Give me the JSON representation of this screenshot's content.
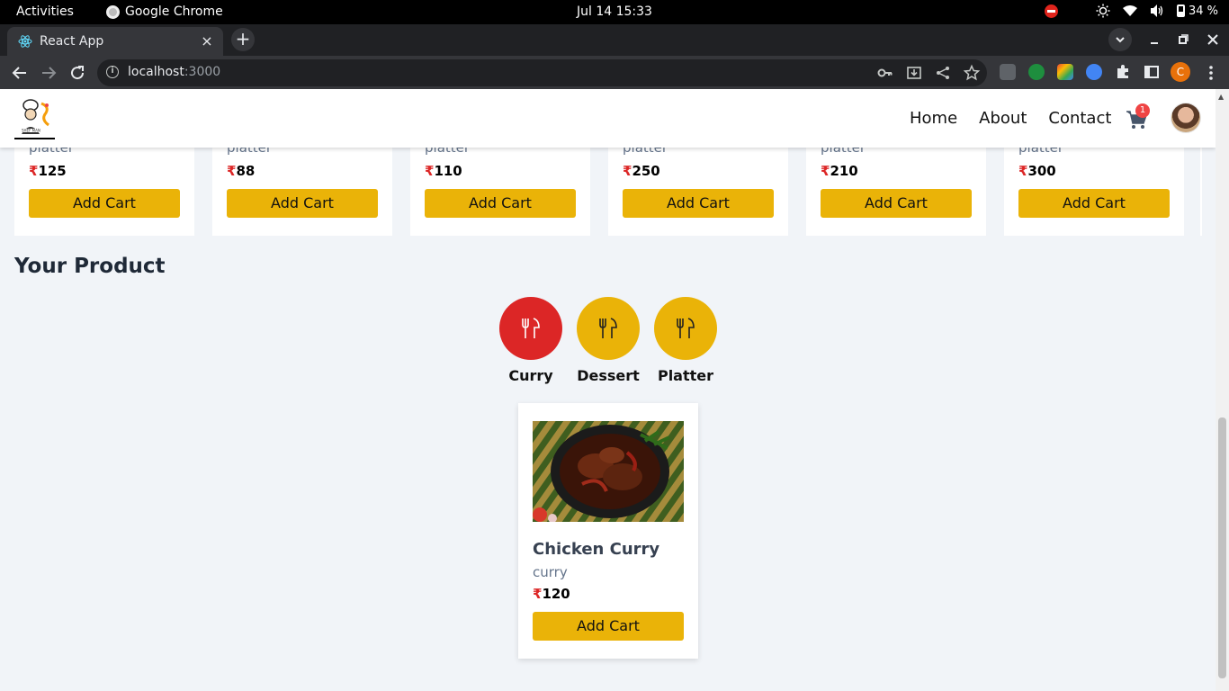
{
  "os": {
    "activities": "Activities",
    "app_name": "Google Chrome",
    "clock": "Jul 14  15:33",
    "battery": "34 %"
  },
  "browser": {
    "tab_title": "React App",
    "tab_close": "×",
    "new_tab": "+",
    "url_host": "localhost",
    "url_port": ":3000",
    "profile_initial": "C"
  },
  "header": {
    "nav": [
      "Home",
      "About",
      "Contact"
    ],
    "cart_count": "1"
  },
  "products_row": [
    {
      "category": "platter",
      "currency": "₹",
      "price": "125",
      "button": "Add Cart"
    },
    {
      "category": "platter",
      "currency": "₹",
      "price": "88",
      "button": "Add Cart"
    },
    {
      "category": "platter",
      "currency": "₹",
      "price": "110",
      "button": "Add Cart"
    },
    {
      "category": "platter",
      "currency": "₹",
      "price": "250",
      "button": "Add Cart"
    },
    {
      "category": "platter",
      "currency": "₹",
      "price": "210",
      "button": "Add Cart"
    },
    {
      "category": "platter",
      "currency": "₹",
      "price": "300",
      "button": "Add Cart"
    }
  ],
  "your_product": {
    "title": "Your Product",
    "filters": [
      {
        "label": "Curry",
        "icon": "cutlery-icon",
        "active": true
      },
      {
        "label": "Dessert",
        "icon": "cutlery-icon",
        "active": false
      },
      {
        "label": "Platter",
        "icon": "cutlery-icon",
        "active": false
      }
    ],
    "results": [
      {
        "name": "Chicken Curry",
        "category": "curry",
        "currency": "₹",
        "price": "120",
        "button": "Add Cart"
      }
    ]
  },
  "colors": {
    "accent": "#eab308",
    "active_filter": "#dc2626",
    "page_bg": "#f1f4f8"
  }
}
